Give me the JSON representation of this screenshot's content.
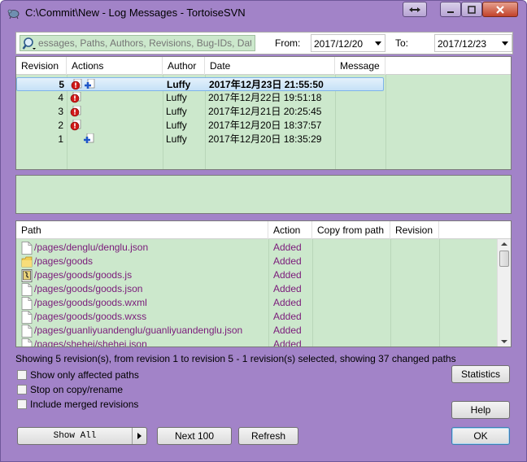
{
  "window": {
    "title": "C:\\Commit\\New - Log Messages - TortoiseSVN",
    "controls": [
      "restore",
      "minimize",
      "maximize",
      "close"
    ]
  },
  "filter": {
    "placeholder": "essages, Paths, Authors, Revisions, Bug-IDs, Date,",
    "from_label": "From:",
    "from_value": "2017/12/20",
    "to_label": "To:",
    "to_value": "2017/12/23"
  },
  "log": {
    "columns": [
      "Revision",
      "Actions",
      "Author",
      "Date",
      "Message"
    ],
    "rows": [
      {
        "revision": "5",
        "author": "Luffy",
        "date": "2017年12月23日 21:55:50",
        "message": "",
        "selected": true,
        "icons": [
          "warning-icon",
          "add-icon"
        ]
      },
      {
        "revision": "4",
        "author": "Luffy",
        "date": "2017年12月22日 19:51:18",
        "message": "",
        "selected": false,
        "icons": [
          "warning-icon"
        ]
      },
      {
        "revision": "3",
        "author": "Luffy",
        "date": "2017年12月21日 20:25:45",
        "message": "",
        "selected": false,
        "icons": [
          "warning-icon"
        ]
      },
      {
        "revision": "2",
        "author": "Luffy",
        "date": "2017年12月20日 18:37:57",
        "message": "",
        "selected": false,
        "icons": [
          "warning-icon"
        ]
      },
      {
        "revision": "1",
        "author": "Luffy",
        "date": "2017年12月20日 18:35:29",
        "message": "",
        "selected": false,
        "icons": [
          "add-icon"
        ]
      }
    ]
  },
  "paths": {
    "columns": [
      "Path",
      "Action",
      "Copy from path",
      "Revision"
    ],
    "rows": [
      {
        "path": "/pages/denglu/denglu.json",
        "action": "Added",
        "icon": "file-icon"
      },
      {
        "path": "/pages/goods",
        "action": "Added",
        "icon": "folder-icon"
      },
      {
        "path": "/pages/goods/goods.js",
        "action": "Added",
        "icon": "script-file-icon"
      },
      {
        "path": "/pages/goods/goods.json",
        "action": "Added",
        "icon": "file-icon"
      },
      {
        "path": "/pages/goods/goods.wxml",
        "action": "Added",
        "icon": "file-icon"
      },
      {
        "path": "/pages/goods/goods.wxss",
        "action": "Added",
        "icon": "file-icon"
      },
      {
        "path": "/pages/guanliyuandenglu/guanliyuandenglu.json",
        "action": "Added",
        "icon": "file-icon"
      },
      {
        "path": "/pages/shehei/shehei.json",
        "action": "Added",
        "icon": "file-icon"
      }
    ]
  },
  "status": "Showing 5 revision(s), from revision 1 to revision 5 - 1 revision(s) selected, showing 37 changed paths",
  "options": {
    "affected": "Show only affected paths",
    "stop_copy": "Stop on copy/rename",
    "merged": "Include merged revisions"
  },
  "buttons": {
    "statistics": "Statistics",
    "help": "Help",
    "show_all": "Show All",
    "next100": "Next 100",
    "refresh": "Refresh",
    "ok": "OK"
  },
  "colors": {
    "window_frame": "#a283c8",
    "list_background": "#cce8cc",
    "path_text": "#7a1a7a",
    "selection": "#c6e1f7"
  }
}
